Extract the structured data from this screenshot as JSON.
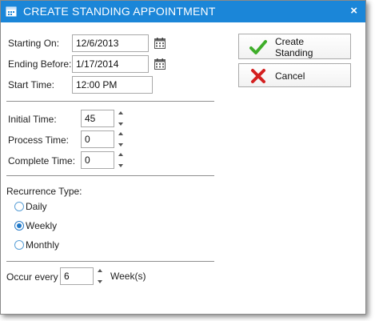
{
  "dialog": {
    "title": "CREATE STANDING APPOINTMENT",
    "close_label": "×"
  },
  "dates": {
    "starting_on_label": "Starting On:",
    "starting_on_value": "12/6/2013",
    "ending_before_label": "Ending Before:",
    "ending_before_value": "1/17/2014",
    "start_time_label": "Start Time:",
    "start_time_value": "12:00 PM"
  },
  "times": {
    "initial_label": "Initial Time:",
    "initial_value": "45",
    "process_label": "Process Time:",
    "process_value": "0",
    "complete_label": "Complete Time:",
    "complete_value": "0"
  },
  "recurrence": {
    "label": "Recurrence Type:",
    "options": [
      {
        "label": "Daily",
        "selected": false
      },
      {
        "label": "Weekly",
        "selected": true
      },
      {
        "label": "Monthly",
        "selected": false
      }
    ]
  },
  "occur": {
    "label": "Occur every",
    "value": "6",
    "unit": "Week(s)"
  },
  "buttons": {
    "create_label_line1": "Create",
    "create_label_line2": "Standing",
    "cancel_label": "Cancel"
  },
  "icons": {
    "title": "calendar-icon",
    "date_picker": "calendar-icon",
    "create": "checkmark-icon",
    "cancel": "cross-icon"
  },
  "colors": {
    "titlebar": "#1b86d8",
    "check": "#3fae2a",
    "cross": "#d42020",
    "radio_selected": "#1f78c8"
  }
}
